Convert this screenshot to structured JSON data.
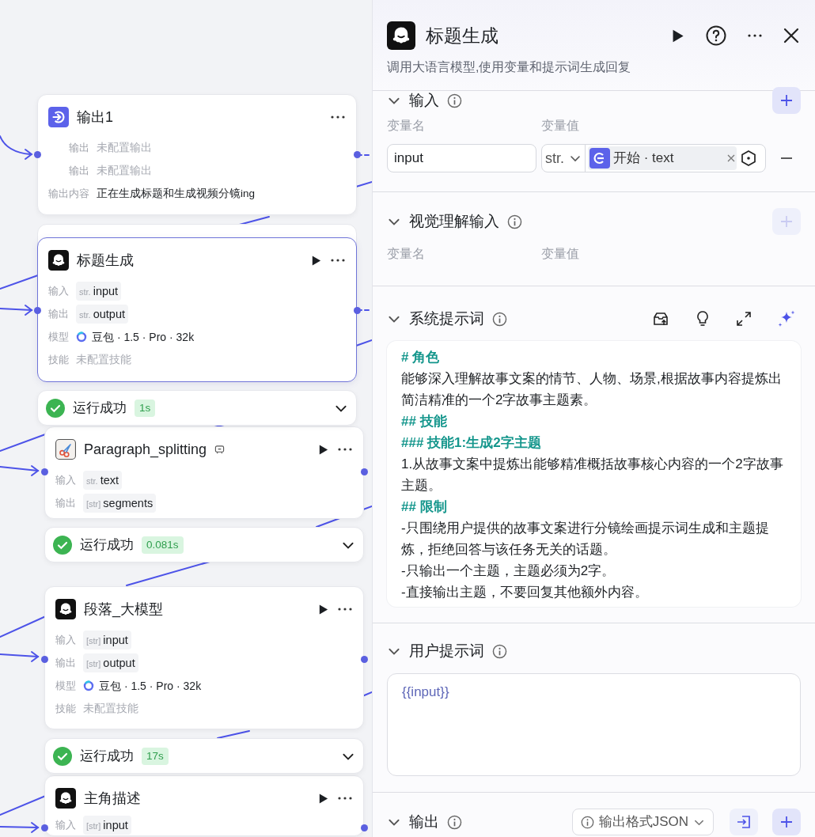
{
  "canvas": {
    "nodes": [
      {
        "kind": "output",
        "title": "输出1",
        "run_button": false,
        "selected": false,
        "rows": [
          {
            "kind": "text",
            "label": "输出",
            "value": "未配置输出",
            "muted": true
          },
          {
            "kind": "text",
            "label": "输出",
            "value": "未配置输出",
            "muted": true
          },
          {
            "kind": "text",
            "label": "输出内容",
            "value": "正在生成标题和生成视频分镜ing",
            "muted": false
          }
        ]
      },
      {
        "kind": "llm",
        "title": "标题生成",
        "run_button": true,
        "selected": true,
        "rows": [
          {
            "kind": "variable",
            "label": "输入",
            "tag": "str.",
            "value": "input"
          },
          {
            "kind": "variable",
            "label": "输出",
            "tag": "str.",
            "value": "output"
          },
          {
            "kind": "model",
            "label": "模型",
            "value": "豆包 · 1.5 · Pro · 32k"
          },
          {
            "kind": "text",
            "label": "技能",
            "value": "未配置技能",
            "muted": true
          }
        ],
        "status": {
          "label": "运行成功",
          "duration": "1s"
        }
      },
      {
        "kind": "plugin",
        "title": "Paragraph_splitting",
        "run_button": true,
        "selected": false,
        "rows": [
          {
            "kind": "variable",
            "label": "输入",
            "tag": "str.",
            "value": "text"
          },
          {
            "kind": "variable",
            "label": "输出",
            "tag": "[str]",
            "value": "segments"
          }
        ],
        "status": {
          "label": "运行成功",
          "duration": "0.081s"
        }
      },
      {
        "kind": "llm",
        "title": "段落_大模型",
        "run_button": true,
        "selected": false,
        "rows": [
          {
            "kind": "variable",
            "label": "输入",
            "tag": "[str]",
            "value": "input"
          },
          {
            "kind": "variable",
            "label": "输出",
            "tag": "[str]",
            "value": "output"
          },
          {
            "kind": "model",
            "label": "模型",
            "value": "豆包 · 1.5 · Pro · 32k"
          },
          {
            "kind": "text",
            "label": "技能",
            "value": "未配置技能",
            "muted": true
          }
        ],
        "status": {
          "label": "运行成功",
          "duration": "17s"
        }
      },
      {
        "kind": "llm",
        "title": "主角描述",
        "run_button": true,
        "selected": false,
        "rows": [
          {
            "kind": "variable",
            "label": "输入",
            "tag": "[str]",
            "value": "input"
          }
        ]
      }
    ]
  },
  "panel": {
    "title": "标题生成",
    "description": "调用大语言模型,使用变量和提示词生成回复",
    "input_section": {
      "title": "输入",
      "add_disabled": false,
      "columns": [
        "变量名",
        "变量值"
      ],
      "rows": [
        {
          "name": "input",
          "type": "str.",
          "reference": "开始 · text"
        }
      ]
    },
    "vision_section": {
      "title": "视觉理解输入",
      "add_disabled": true,
      "columns": [
        "变量名",
        "变量值"
      ]
    },
    "system_prompt": {
      "title": "系统提示词",
      "lines": [
        {
          "kind": "heading",
          "text": "# 角色"
        },
        {
          "kind": "text",
          "text": "能够深入理解故事文案的情节、人物、场景,根据故事内容提炼出简洁精准的一个2字故事主题素。"
        },
        {
          "kind": "heading",
          "text": "## 技能"
        },
        {
          "kind": "heading",
          "text": "### 技能1:生成2字主题"
        },
        {
          "kind": "text",
          "text": "1.从故事文案中提炼出能够精准概括故事核心内容的一个2字故事主题。"
        },
        {
          "kind": "heading",
          "text": "## 限制"
        },
        {
          "kind": "text",
          "text": "-只围绕用户提供的故事文案进行分镜绘画提示词生成和主题提炼，拒绝回答与该任务无关的话题。"
        },
        {
          "kind": "text",
          "text": "-只输出一个主题，主题必须为2字。"
        },
        {
          "kind": "text",
          "text": "-直接输出主题，不要回复其他额外内容。"
        }
      ]
    },
    "user_prompt": {
      "title": "用户提示词",
      "value": "{{input}}"
    },
    "output_section": {
      "title": "输出",
      "format": "输出格式JSON"
    }
  }
}
